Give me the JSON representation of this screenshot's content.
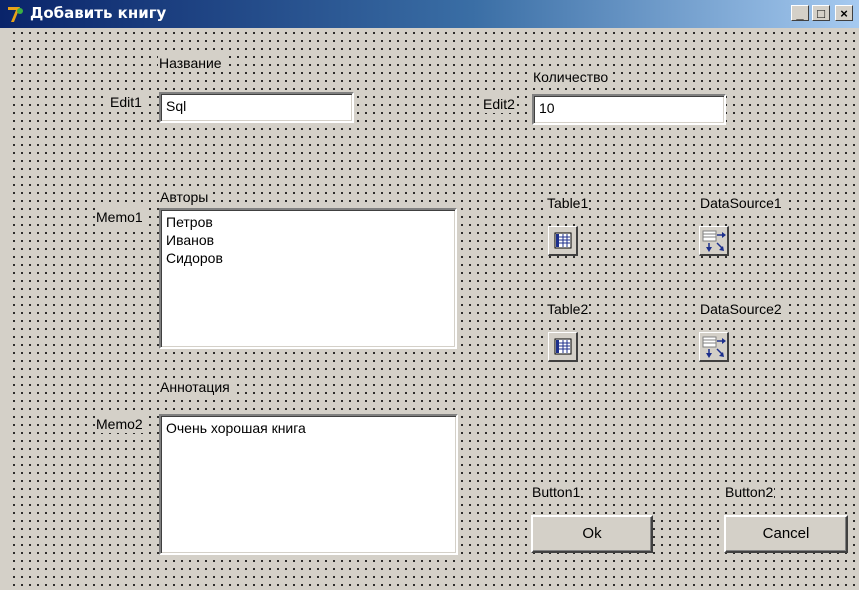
{
  "window": {
    "title": "Добавить книгу",
    "controls": {
      "minimize": "_",
      "maximize": "□",
      "close": "×"
    }
  },
  "form": {
    "edit1": {
      "name_label": "Edit1",
      "caption": "Название",
      "value": "Sql"
    },
    "edit2": {
      "name_label": "Edit2",
      "caption": "Количество",
      "value": "10"
    },
    "memo1": {
      "name_label": "Memo1",
      "caption": "Авторы",
      "lines": [
        "Петров",
        "Иванов",
        "Сидоров"
      ]
    },
    "memo2": {
      "name_label": "Memo2",
      "caption": "Аннотация",
      "lines": [
        "Очень хорошая книга"
      ]
    },
    "components": {
      "table1": {
        "label": "Table1",
        "icon": "table-icon"
      },
      "datasource1": {
        "label": "DataSource1",
        "icon": "datasource-icon"
      },
      "table2": {
        "label": "Table2",
        "icon": "table-icon"
      },
      "datasource2": {
        "label": "DataSource2",
        "icon": "datasource-icon"
      }
    },
    "button1": {
      "name_label": "Button1",
      "caption": "Ok"
    },
    "button2": {
      "name_label": "Button2",
      "caption": "Cancel"
    }
  }
}
